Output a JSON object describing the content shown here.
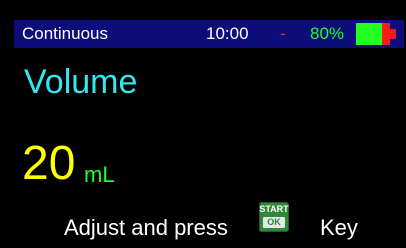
{
  "status_bar": {
    "mode": "Continuous",
    "time": "10:00",
    "separator": "-",
    "battery_percent": "80%",
    "battery_level": 0.8,
    "colors": {
      "background": "#0c0c7a",
      "mode_text": "#ffffff",
      "time_text": "#ffffff",
      "separator": "#ff2020",
      "battery_text": "#22ff22",
      "battery_fill": "#22ff22",
      "battery_cap": "#ff1a1a"
    }
  },
  "parameter": {
    "title": "Volume",
    "value": "20",
    "unit": "mL",
    "colors": {
      "title": "#33e6f0",
      "value": "#ffff00",
      "unit": "#22ff22"
    }
  },
  "instruction": {
    "before_key": "Adjust and press",
    "after_key": "Key",
    "key": {
      "icon": "start-ok-key-icon",
      "top_label": "START",
      "bottom_label": "OK",
      "color": "#2e8a3a"
    }
  }
}
